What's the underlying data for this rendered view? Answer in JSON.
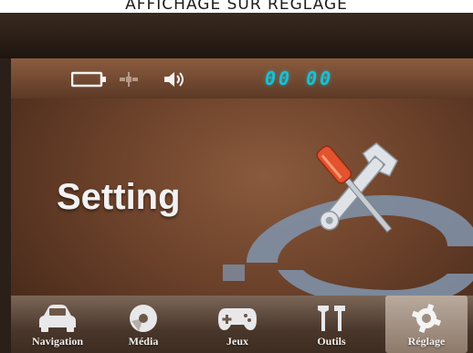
{
  "caption": "AFFICHAGE SUR REGLAGE",
  "status": {
    "icons": [
      "battery-icon",
      "satellite-icon",
      "volume-icon"
    ],
    "clock": "00 00"
  },
  "main": {
    "title": "Setting",
    "illustration": "wrench-screwdriver-icon"
  },
  "nav": {
    "items": [
      {
        "label": "Navigation",
        "icon": "car-icon",
        "active": false
      },
      {
        "label": "Média",
        "icon": "media-icon",
        "active": false
      },
      {
        "label": "Jeux",
        "icon": "gamepad-icon",
        "active": false
      },
      {
        "label": "Outils",
        "icon": "tools-icon",
        "active": false
      },
      {
        "label": "Réglage",
        "icon": "gear-icon",
        "active": true
      }
    ]
  },
  "colors": {
    "clock": "#19c1d6",
    "screen_bg": "#6b412a",
    "nav_bg": "#4a372b",
    "active_tab": "#b9aa9d",
    "ring": "#7f90a6"
  }
}
